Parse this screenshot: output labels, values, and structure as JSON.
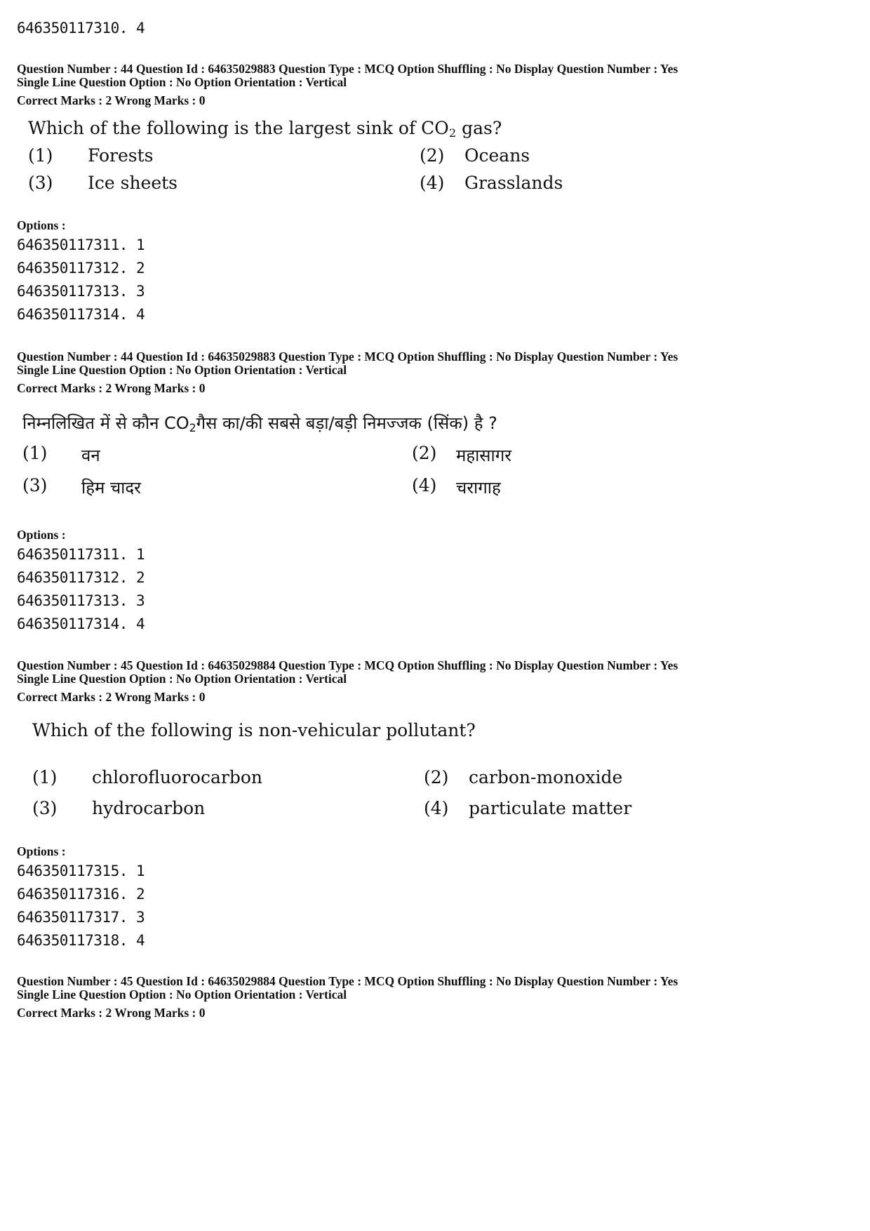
{
  "prev_option": "646350117310. 4",
  "questions": [
    {
      "meta_line1": "Question Number : 44  Question Id : 64635029883  Question Type : MCQ  Option Shuffling : No  Display Question Number : Yes",
      "meta_line2": "Single Line Question Option : No  Option Orientation : Vertical",
      "marks": "Correct Marks : 2  Wrong Marks : 0",
      "question_pre": "Which of the following is the largest sink of CO",
      "question_sub": "2",
      "question_post": " gas?",
      "choices": [
        {
          "num": "(1)",
          "text": "Forests"
        },
        {
          "num": "(2)",
          "text": "Oceans"
        },
        {
          "num": "(3)",
          "text": "Ice sheets"
        },
        {
          "num": "(4)",
          "text": "Grasslands"
        }
      ],
      "options_label": "Options :",
      "options": [
        "646350117311. 1",
        "646350117312. 2",
        "646350117313. 3",
        "646350117314. 4"
      ]
    },
    {
      "meta_line1": "Question Number : 44  Question Id : 64635029883  Question Type : MCQ  Option Shuffling : No  Display Question Number : Yes",
      "meta_line2": "Single Line Question Option : No  Option Orientation : Vertical",
      "marks": "Correct Marks : 2  Wrong Marks : 0",
      "question_pre": "निम्नलिखित में से कौन CO",
      "question_sub": "2",
      "question_post": "गैस का/की सबसे बड़ा/बड़ी निमज्जक (सिंक) है ?",
      "choices": [
        {
          "num": "(1)",
          "text": "वन"
        },
        {
          "num": "(2)",
          "text": "महासागर"
        },
        {
          "num": "(3)",
          "text": "हिम चादर"
        },
        {
          "num": "(4)",
          "text": "चरागाह"
        }
      ],
      "options_label": "Options :",
      "options": [
        "646350117311. 1",
        "646350117312. 2",
        "646350117313. 3",
        "646350117314. 4"
      ]
    },
    {
      "meta_line1": "Question Number : 45  Question Id : 64635029884  Question Type : MCQ  Option Shuffling : No  Display Question Number : Yes",
      "meta_line2": "Single Line Question Option : No  Option Orientation : Vertical",
      "marks": "Correct Marks : 2  Wrong Marks : 0",
      "question_text": "Which of the following is non-vehicular pollutant?",
      "choices": [
        {
          "num": "(1)",
          "text": "chlorofluorocarbon"
        },
        {
          "num": "(2)",
          "text": "carbon-monoxide"
        },
        {
          "num": "(3)",
          "text": "hydrocarbon"
        },
        {
          "num": "(4)",
          "text": "particulate matter"
        }
      ],
      "options_label": "Options :",
      "options": [
        "646350117315. 1",
        "646350117316. 2",
        "646350117317. 3",
        "646350117318. 4"
      ]
    },
    {
      "meta_line1": "Question Number : 45  Question Id : 64635029884  Question Type : MCQ  Option Shuffling : No  Display Question Number : Yes",
      "meta_line2": "Single Line Question Option : No  Option Orientation : Vertical",
      "marks": "Correct Marks : 2  Wrong Marks : 0"
    }
  ]
}
